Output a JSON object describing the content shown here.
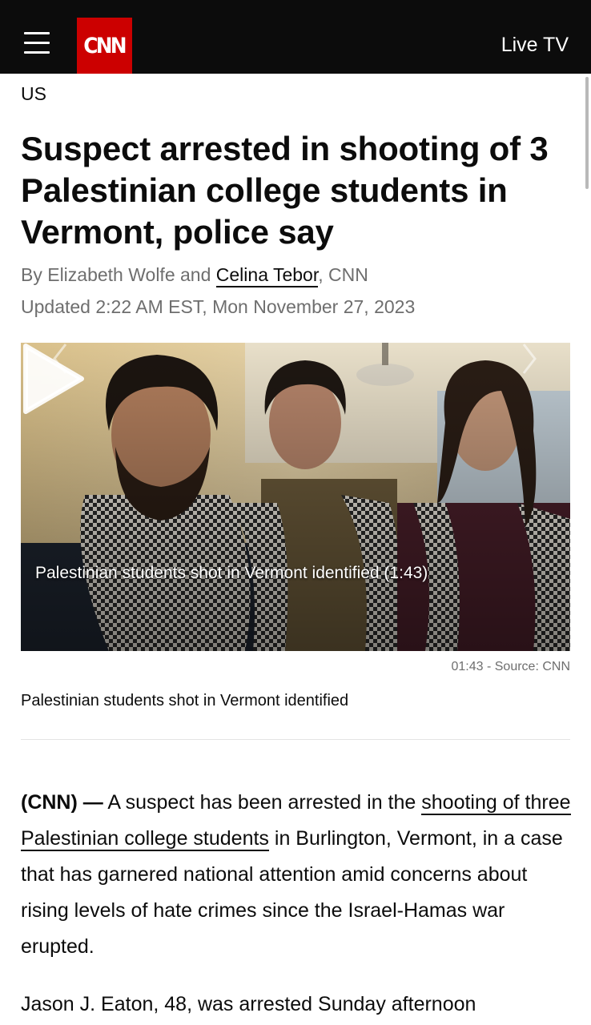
{
  "header": {
    "logo_text": "CNN",
    "live_tv_label": "Live TV",
    "brand_color": "#cc0000",
    "bar_color": "#0c0c0c"
  },
  "article": {
    "section": "US",
    "headline": "Suspect arrested in shooting of 3 Palestinian college students in Vermont, police say",
    "byline": {
      "prefix": "By Elizabeth Wolfe and ",
      "linked_author": "Celina Tebor",
      "suffix": ", CNN"
    },
    "updated": "Updated 2:22 AM EST, Mon November 27, 2023",
    "video": {
      "overlay_title": "Palestinian students shot in Vermont identified (1:43)",
      "duration_source": "01:43 - Source: CNN",
      "caption": "Palestinian students shot in Vermont identified",
      "icons": [
        "play-icon",
        "chevron-left-icon",
        "chevron-right-icon"
      ]
    },
    "paragraph1": {
      "dateline": "(CNN) —",
      "text_before_link": " A suspect has been arrested in the ",
      "link_text": "shooting of three Palestinian college students",
      "text_after_link": " in Burlington, Vermont, in a case that has garnered national attention amid concerns about rising levels of hate crimes since the Israel-Hamas war erupted."
    },
    "paragraph2": {
      "text": "Jason J. Eaton, 48, was arrested Sunday afternoon"
    }
  }
}
